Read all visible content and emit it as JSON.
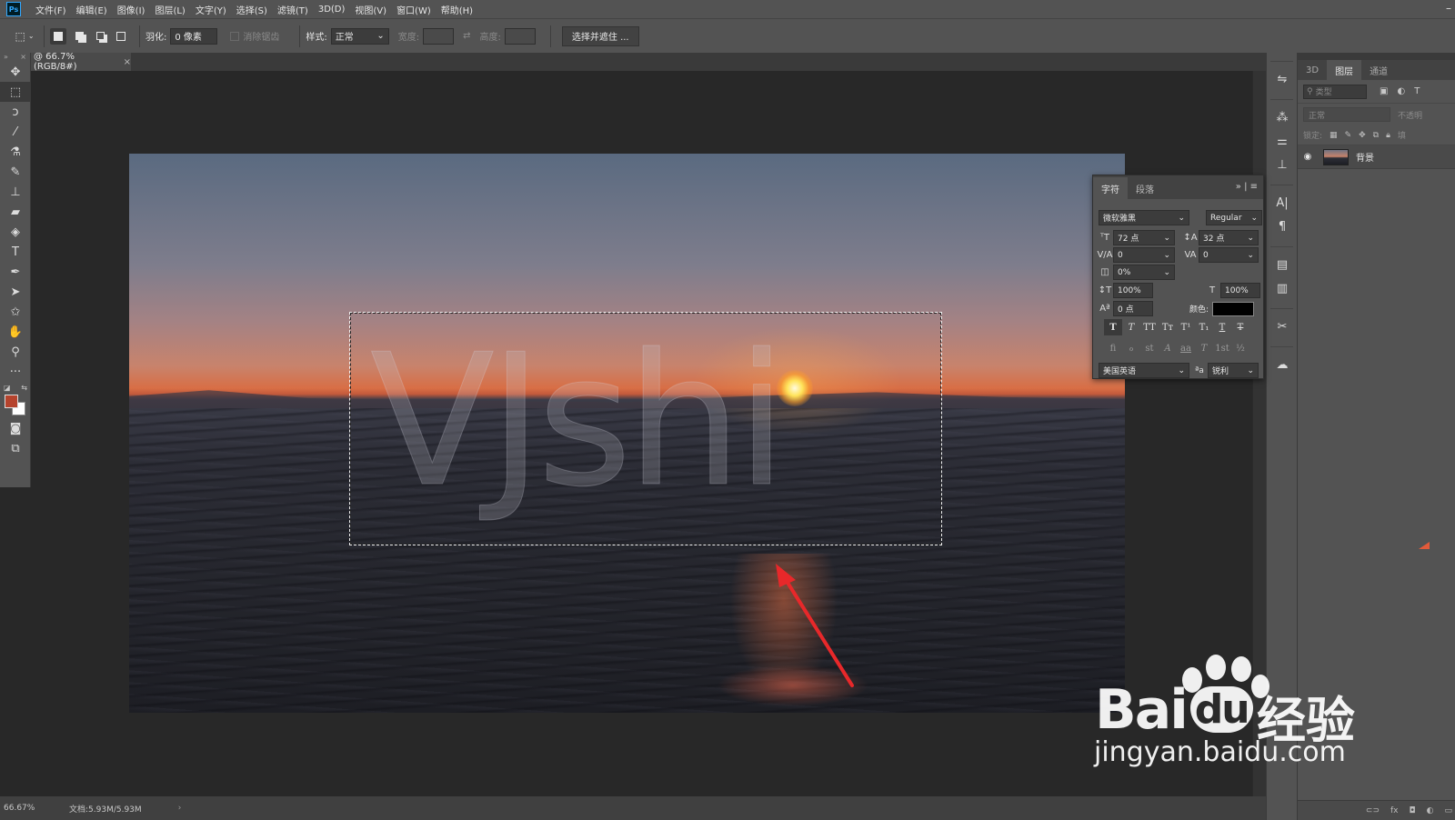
{
  "app": {
    "logo": "Ps"
  },
  "menu": [
    "文件(F)",
    "编辑(E)",
    "图像(I)",
    "图层(L)",
    "文字(Y)",
    "选择(S)",
    "滤镜(T)",
    "3D(D)",
    "视图(V)",
    "窗口(W)",
    "帮助(H)"
  ],
  "options": {
    "feather_label": "羽化:",
    "feather_value": "0 像素",
    "antialias_label": "消除锯齿",
    "style_label": "样式:",
    "style_value": "正常",
    "width_label": "宽度:",
    "height_label": "高度:",
    "select_mask_button": "选择并遮住 ..."
  },
  "document": {
    "tab_title": "@ 66.7%(RGB/8#)",
    "close_glyph": "×"
  },
  "canvas": {
    "watermark_text": "VJshi"
  },
  "status": {
    "zoom": "66.67%",
    "doc_size": "文档:5.93M/5.93M",
    "chevron": "›"
  },
  "character_panel": {
    "tabs": [
      "字符",
      "段落"
    ],
    "font_family": "微软雅黑",
    "font_style": "Regular",
    "font_size": "72 点",
    "leading": "32 点",
    "kerning": "0",
    "tracking": "0",
    "tsume": "0%",
    "vertical_scale": "100%",
    "horizontal_scale": "100%",
    "baseline_shift": "0 点",
    "color_label": "颜色:",
    "color_value": "#000000",
    "style_buttons": [
      "T",
      "T",
      "TT",
      "Tт",
      "T¹",
      "T₁",
      "T",
      "T"
    ],
    "opentype_buttons": [
      "fi",
      "ℴ",
      "st",
      "A",
      "aa",
      "T",
      "1st",
      "½"
    ],
    "language": "美国英语",
    "aa_label": "ªa",
    "antialias": "锐利"
  },
  "layers_panel": {
    "tabs": [
      "3D",
      "图层",
      "通道"
    ],
    "search_placeholder": "类型",
    "blend_mode": "正常",
    "opacity_label": "不透明",
    "lock_label": "锁定:",
    "fill_label": "填",
    "layer_name": "背景"
  },
  "watermark": {
    "brand": "Bai",
    "brand2": "du",
    "cn": "经验",
    "url": "jingyan.baidu.com"
  }
}
